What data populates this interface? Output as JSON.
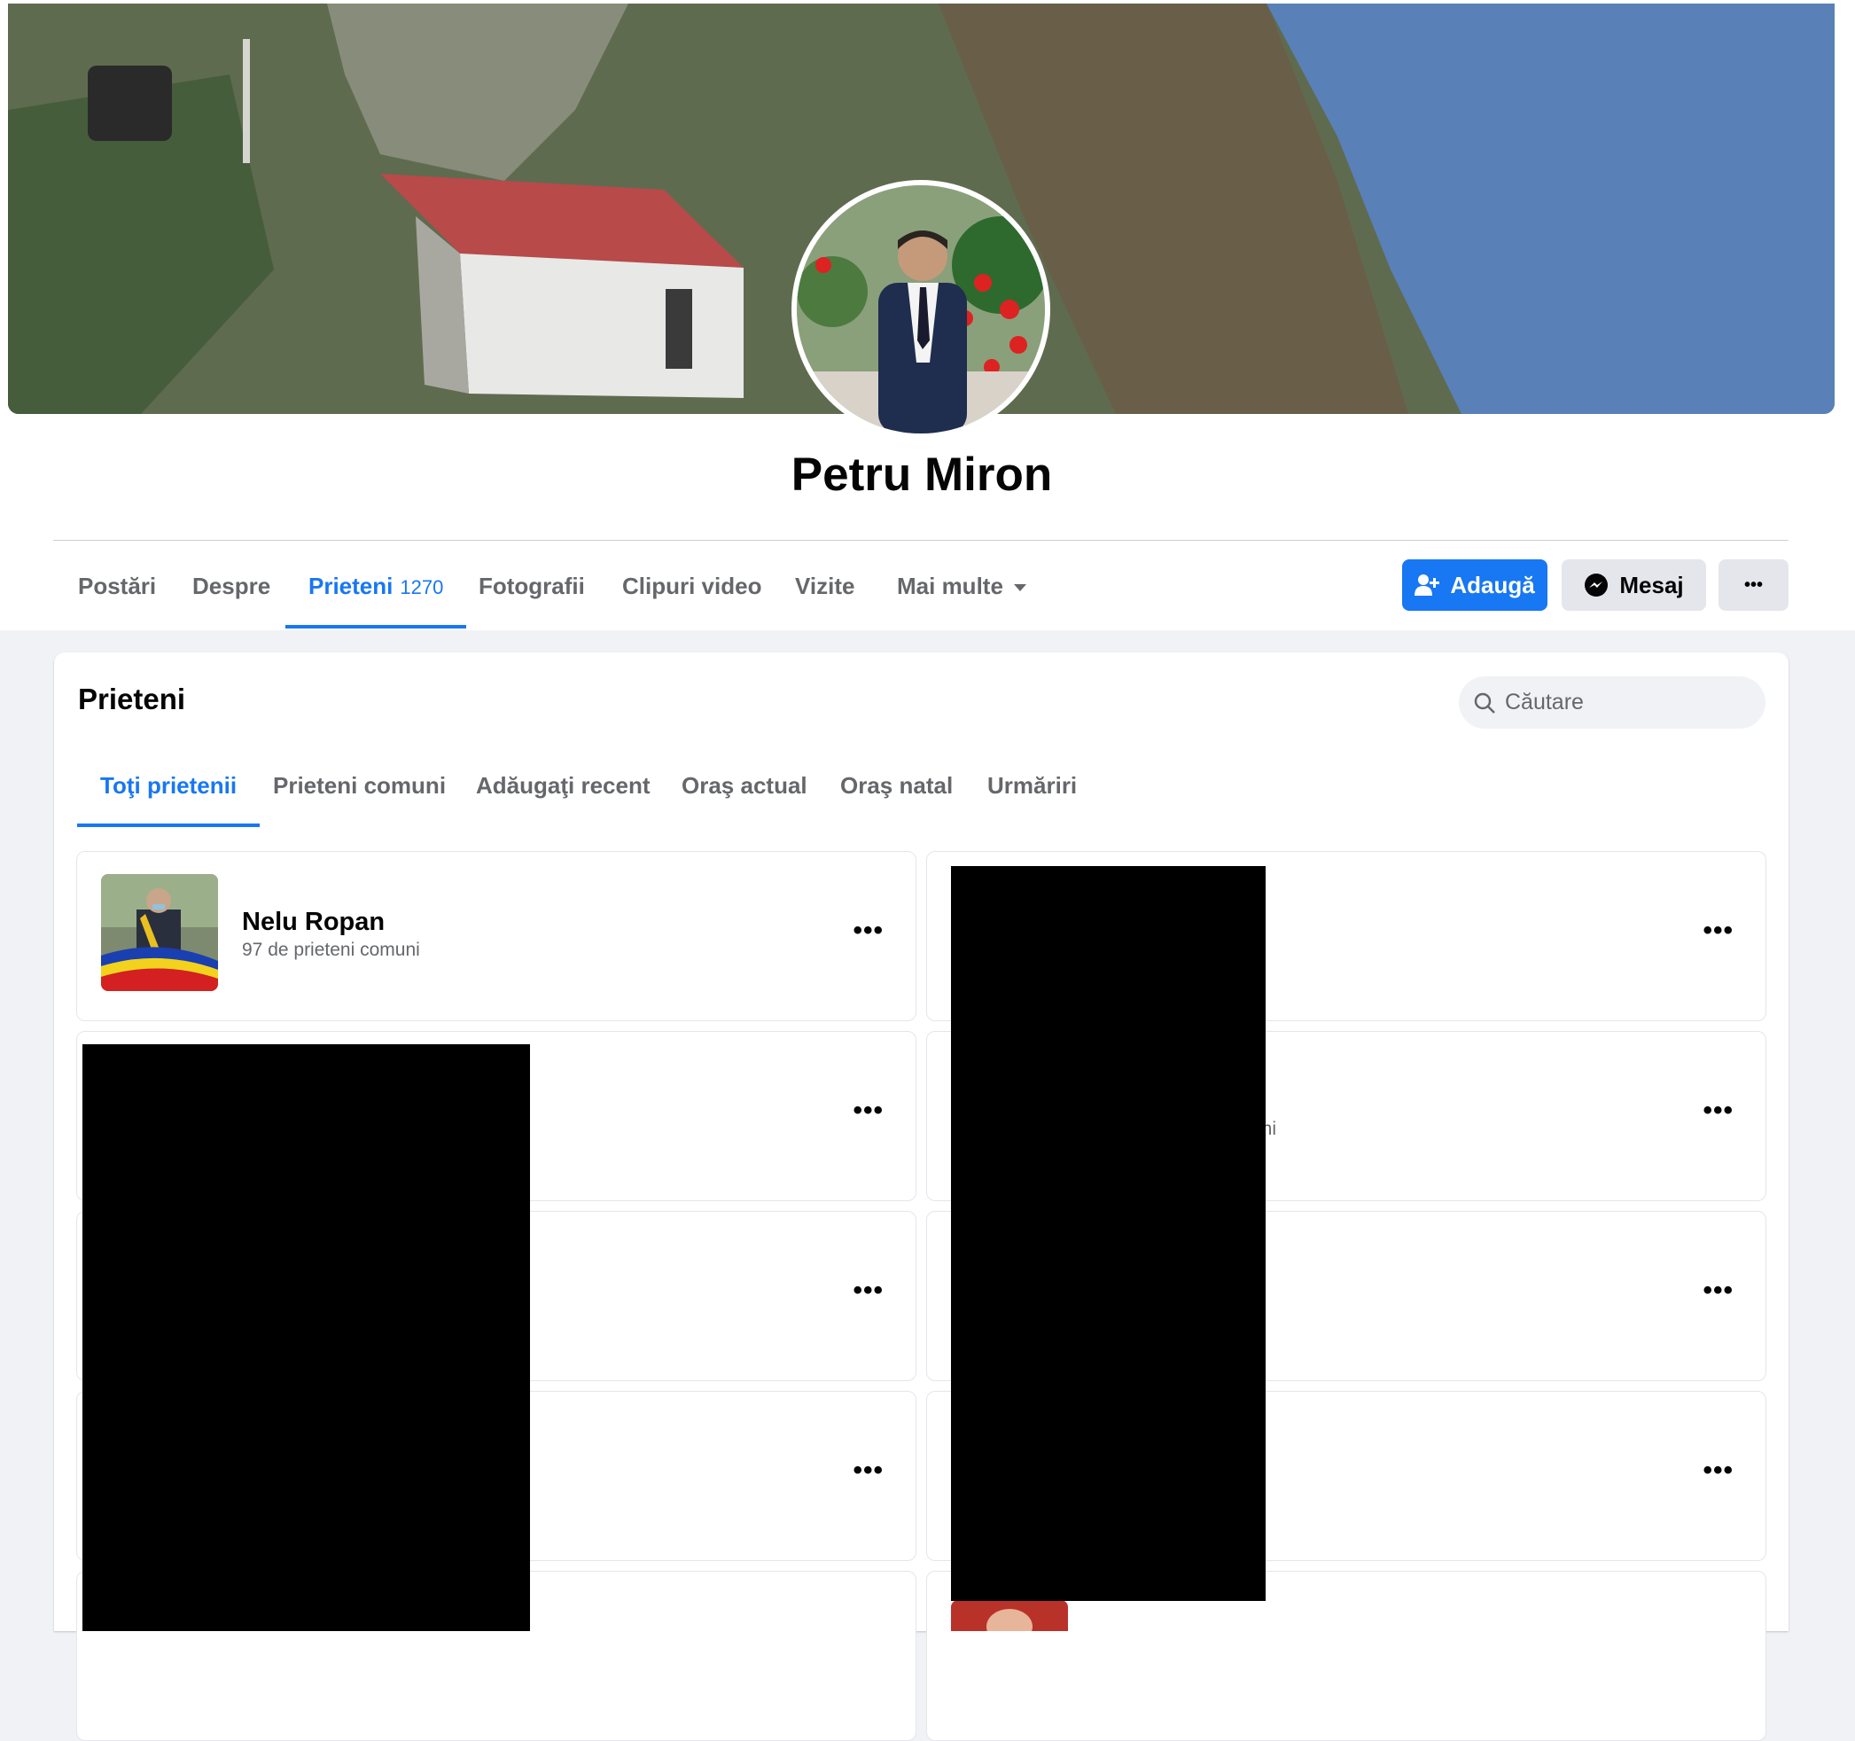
{
  "profile": {
    "name": "Petru Miron"
  },
  "profile_tabs": [
    {
      "label": "Postări"
    },
    {
      "label": "Despre"
    },
    {
      "label": "Prieteni",
      "count": "1270"
    },
    {
      "label": "Fotografii"
    },
    {
      "label": "Clipuri video"
    },
    {
      "label": "Vizite"
    },
    {
      "label": "Mai multe"
    }
  ],
  "actions": {
    "add": "Adaugă",
    "message": "Mesaj",
    "more": "•••"
  },
  "friends": {
    "title": "Prieteni",
    "search_placeholder": "Căutare",
    "tabs": [
      {
        "label": "Toţi prietenii"
      },
      {
        "label": "Prieteni comuni"
      },
      {
        "label": "Adăugaţi recent"
      },
      {
        "label": "Oraş actual"
      },
      {
        "label": "Oraş natal"
      },
      {
        "label": "Urmăriri"
      }
    ],
    "list": [
      {
        "name": "Nelu Ropan",
        "mutual": "97 de prieteni comuni"
      }
    ],
    "partial_text": [
      "uni",
      "ni"
    ],
    "item_menu": "•••"
  },
  "colors": {
    "accent": "#1877f2",
    "background": "#f0f2f5"
  }
}
